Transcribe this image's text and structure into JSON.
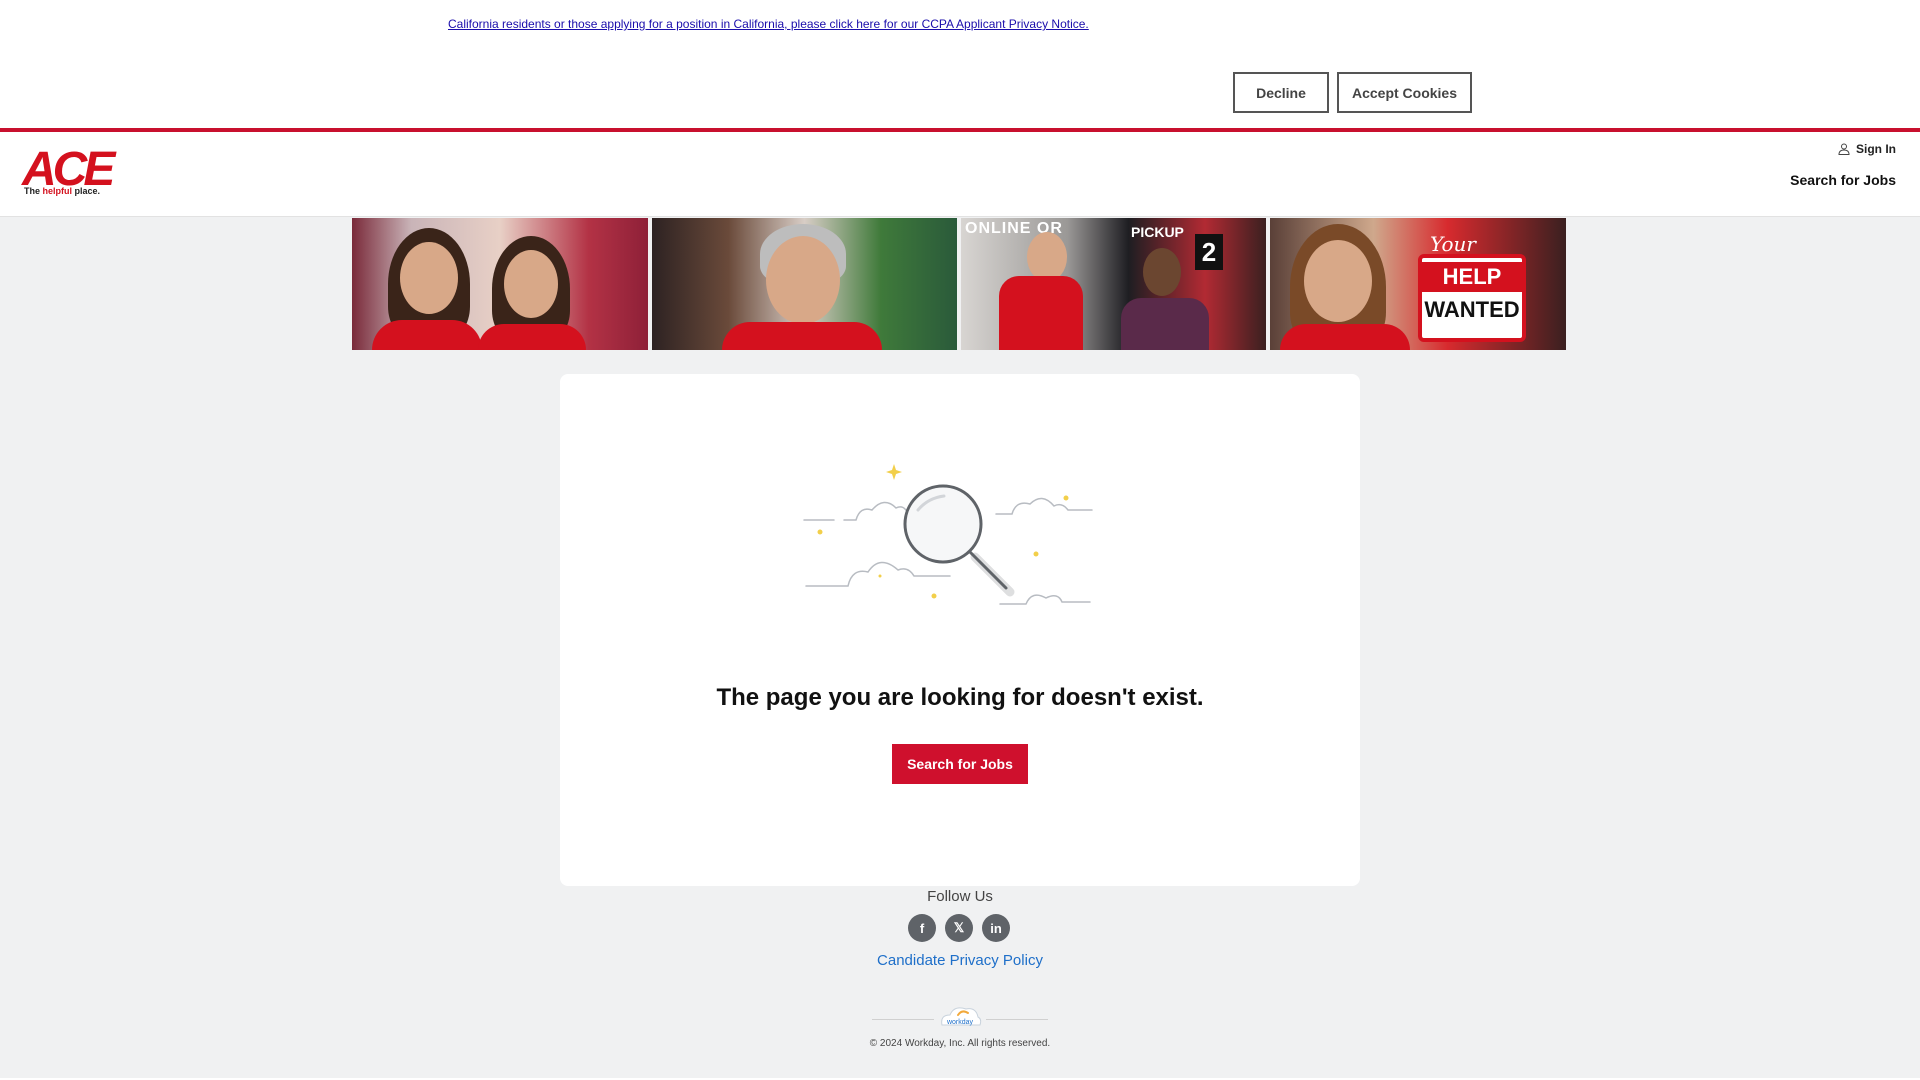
{
  "cookie_banner": {
    "ccpa_notice": "California residents or those applying for a position in California, please click here for our CCPA Applicant Privacy Notice.",
    "decline_label": "Decline",
    "accept_label": "Accept Cookies"
  },
  "header": {
    "logo_text": "ACE",
    "logo_tagline_prefix": "The ",
    "logo_tagline_highlight": "helpful",
    "logo_tagline_suffix": " place.",
    "sign_in_label": "Sign In",
    "search_jobs_label": "Search for Jobs",
    "brand_color": "#d4111e"
  },
  "hero": {
    "panel2_online": "ONLINE OR",
    "panel3_pickup": "PICKUP",
    "panel3_number": "2",
    "panel4_your": "Your",
    "panel4_help": "HELP",
    "panel4_wanted": "WANTED"
  },
  "main": {
    "illustration_icon": "magnifying-glass-icon",
    "error_title": "The page you are looking for doesn't exist.",
    "search_button_label": "Search for Jobs",
    "button_color": "#cf102d"
  },
  "footer": {
    "follow_label": "Follow Us",
    "social": [
      {
        "icon": "facebook-icon",
        "glyph": "f"
      },
      {
        "icon": "x-icon",
        "glyph": "𝕏"
      },
      {
        "icon": "linkedin-icon",
        "glyph": "in"
      }
    ],
    "privacy_label": "Candidate Privacy Policy",
    "workday_logo_text": "workday",
    "copyright": "© 2024 Workday, Inc. All rights reserved."
  }
}
